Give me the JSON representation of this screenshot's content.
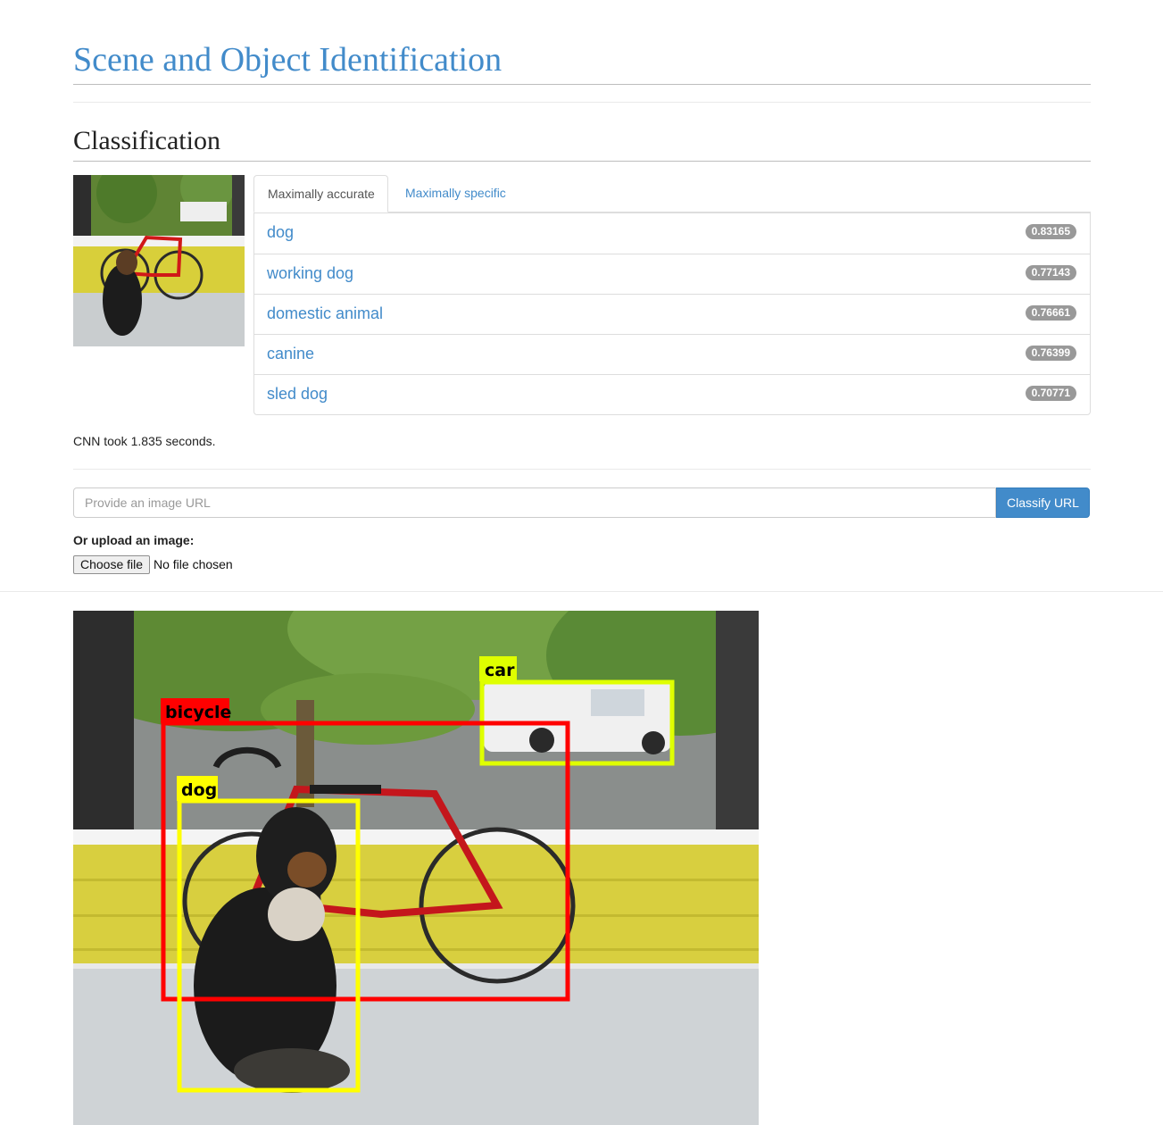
{
  "header": {
    "title": "Scene and Object Identification"
  },
  "classification": {
    "heading": "Classification",
    "tabs": [
      {
        "label": "Maximally accurate",
        "active": true
      },
      {
        "label": "Maximally specific",
        "active": false
      }
    ],
    "results": [
      {
        "label": "dog",
        "score": "0.83165"
      },
      {
        "label": "working dog",
        "score": "0.77143"
      },
      {
        "label": "domestic animal",
        "score": "0.76661"
      },
      {
        "label": "canine",
        "score": "0.76399"
      },
      {
        "label": "sled dog",
        "score": "0.70771"
      }
    ],
    "timing": "CNN took 1.835 seconds."
  },
  "form": {
    "url_placeholder": "Provide an image URL",
    "url_value": "",
    "classify_label": "Classify URL",
    "upload_label": "Or upload an image:",
    "choose_file_label": "Choose file",
    "file_status": "No file chosen"
  },
  "detection": {
    "labels": {
      "car": "car",
      "bicycle": "bicycle",
      "dog": "dog"
    },
    "colors": {
      "car": "#dfff00",
      "bicycle": "#ff0000",
      "dog": "#ffff00"
    }
  },
  "theme": {
    "accent": "#428bca",
    "badge": "#999999"
  }
}
